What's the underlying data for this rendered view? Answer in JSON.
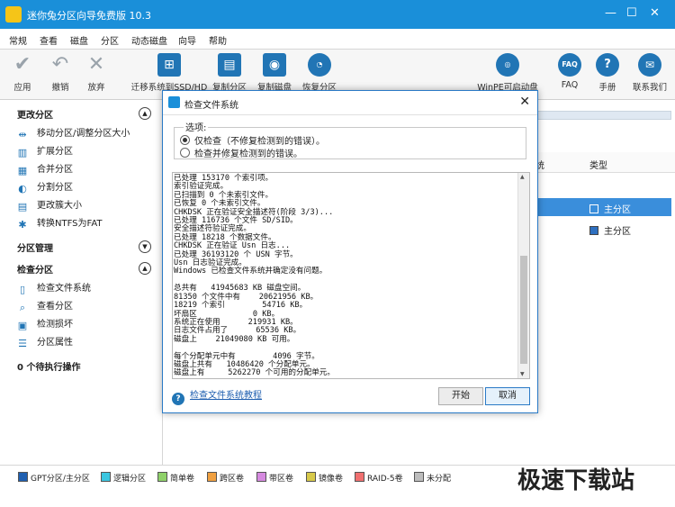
{
  "app": {
    "title": "迷你兔分区向导免费版 10.3"
  },
  "menu": [
    "常规",
    "查看",
    "磁盘",
    "分区",
    "动态磁盘",
    "向导",
    "帮助"
  ],
  "toolbar": {
    "apply": "应用",
    "undo": "撤销",
    "discard": "放弃",
    "migrate": "迁移系统到SSD/HD",
    "copy_partition": "复制分区",
    "copy_disk": "复制磁盘",
    "recover": "恢复分区",
    "winpe": "WinPE可启动盘",
    "faq": "FAQ",
    "manual": "手册",
    "contact": "联系我们",
    "faq_icon_text": "FAQ"
  },
  "sidebar": {
    "sec1": "更改分区",
    "sec1_items": [
      "移动分区/调整分区大小",
      "扩展分区",
      "合并分区",
      "分割分区",
      "更改簇大小",
      "转换NTFS为FAT"
    ],
    "sec2": "分区管理",
    "sec3": "检查分区",
    "sec3_items": [
      "检查文件系统",
      "查看分区",
      "检测损坏",
      "分区属性"
    ],
    "pending": "0 个待执行操作"
  },
  "main": {
    "col_fs": "统",
    "col_type": "类型",
    "row1_type": "主分区",
    "row2_type": "主分区"
  },
  "legend": [
    "GPT分区/主分区",
    "逻辑分区",
    "简单卷",
    "跨区卷",
    "带区卷",
    "镜像卷",
    "RAID-5卷",
    "未分配"
  ],
  "legend_colors": [
    "#1f5fb0",
    "#3bc6e0",
    "#8fd16a",
    "#f0a040",
    "#d68ae0",
    "#d7c94a",
    "#f07070",
    "#bdbdbd"
  ],
  "watermark": "极速下载站",
  "dialog": {
    "title": "检查文件系统",
    "options_label": "选项:",
    "opt1": "仅检查（不修复检测到的错误）。",
    "opt2": "检查并修复检测到的错误。",
    "log": "已处理 153170 个索引项。\n索引验证完成。\n已扫描到 0 个未索引文件。\n已恢复 0 个未索引文件。\nCHKDSK 正在验证安全描述符(阶段 3/3)...\n已处理 116736 个文件 SD/SID。\n安全描述符验证完成。\n已处理 18218 个数据文件。\nCHKDSK 正在验证 Usn 日志...\n已处理 36193120 个 USN 字节。\nUsn 日志验证完成。\nWindows 已检查文件系统并确定没有问题。\n\n总共有   41945683 KB 磁盘空间。\n81350 个文件中有    20621956 KB。\n18219 个索引        54716 KB。\n坏扇区            0 KB。\n系统正在使用      219931 KB。\n日志文件占用了      65536 KB。\n磁盘上    21049080 KB 可用。\n\n每个分配单元中有        4096 字节。\n磁盘上共有   10486420 个分配单元。\n磁盘上有     5262270 个可用的分配单元。",
    "help_link": "检查文件系统教程",
    "start": "开始",
    "cancel": "取消"
  }
}
